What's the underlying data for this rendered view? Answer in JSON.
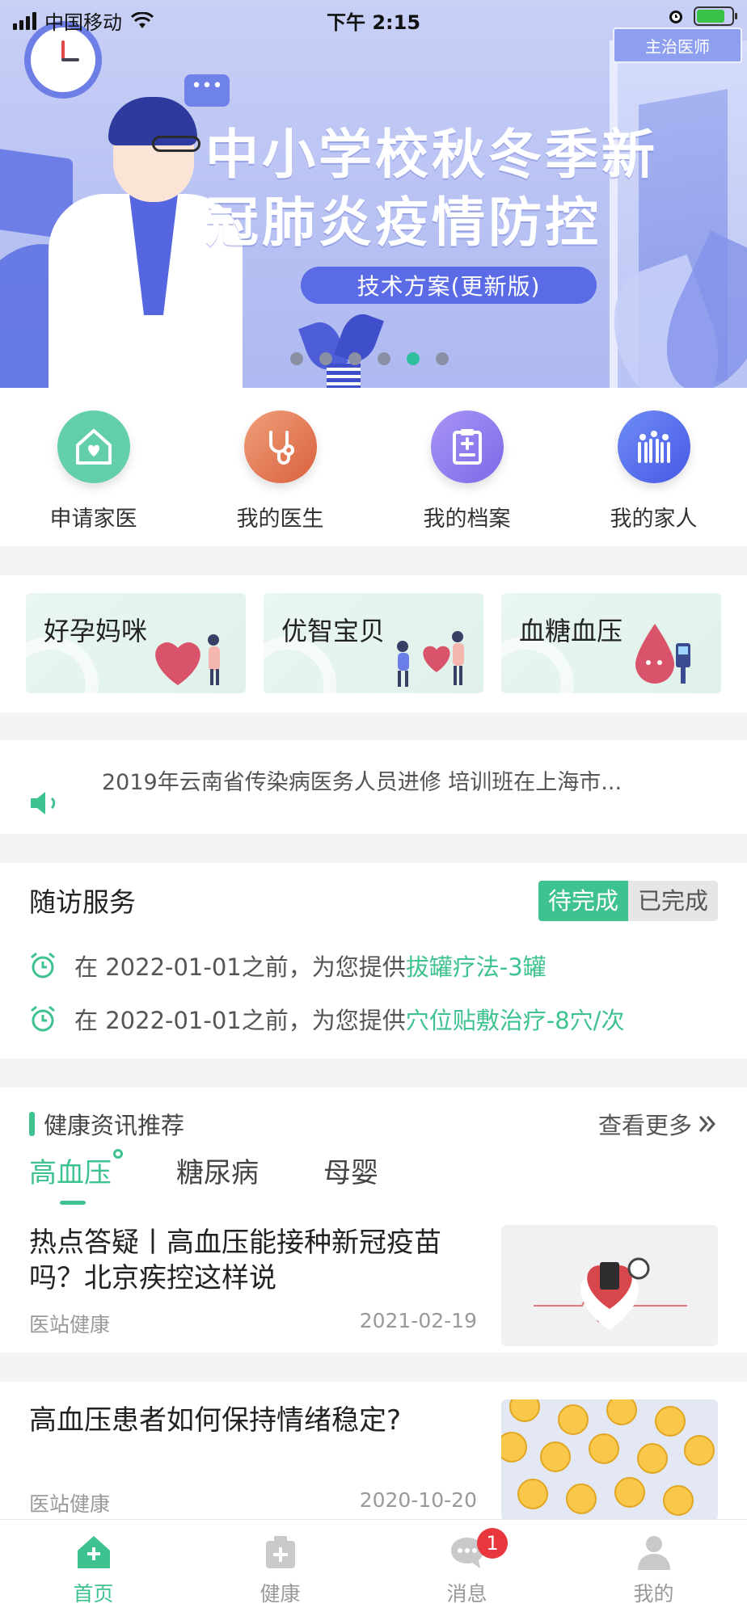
{
  "status_bar": {
    "carrier": "中国移动",
    "time": "下午 2:15"
  },
  "banner": {
    "tag": "主治医师",
    "headline_line1": "中小学校秋冬季新",
    "headline_line2": "冠肺炎疫情防控",
    "subtitle": "技术方案(更新版)",
    "dots_total": 6,
    "dots_active_index": 4
  },
  "quick_entries": [
    {
      "label": "申请家医",
      "icon": "house-heart-icon",
      "color": "#62cfa9"
    },
    {
      "label": "我的医生",
      "icon": "stethoscope-icon",
      "color": "#e57e5b"
    },
    {
      "label": "我的档案",
      "icon": "clipboard-icon",
      "color": "#8f7ff0"
    },
    {
      "label": "我的家人",
      "icon": "family-icon",
      "color": "#5b73f0"
    }
  ],
  "feature_cards": [
    {
      "label": "好孕妈咪"
    },
    {
      "label": "优智宝贝"
    },
    {
      "label": "血糖血压"
    }
  ],
  "notice": {
    "text": "2019年云南省传染病医务人员进修 培训班在上海市..."
  },
  "follow_up": {
    "title": "随访服务",
    "tab_pending": "待完成",
    "tab_done": "已完成",
    "items": [
      {
        "prefix": "在 2022-01-01之前，为您提供",
        "highlight": "拔罐疗法-3罐"
      },
      {
        "prefix": "在 2022-01-01之前，为您提供",
        "highlight": "穴位贴敷治疗-8穴/次"
      }
    ]
  },
  "news": {
    "title": "健康资讯推荐",
    "more": "查看更多",
    "tabs": [
      "高血压",
      "糖尿病",
      "母婴"
    ],
    "active_tab": 0,
    "articles": [
      {
        "title": "热点答疑丨高血压能接种新冠疫苗吗？北京疾控这样说",
        "source": "医站健康",
        "date": "2021-02-19"
      },
      {
        "title": "高血压患者如何保持情绪稳定?",
        "source": "医站健康",
        "date": "2020-10-20"
      }
    ]
  },
  "tab_bar": {
    "items": [
      {
        "label": "首页",
        "active": true
      },
      {
        "label": "健康",
        "active": false
      },
      {
        "label": "消息",
        "active": false,
        "badge": "1"
      },
      {
        "label": "我的",
        "active": false
      }
    ],
    "accent": "#3ec28f"
  }
}
